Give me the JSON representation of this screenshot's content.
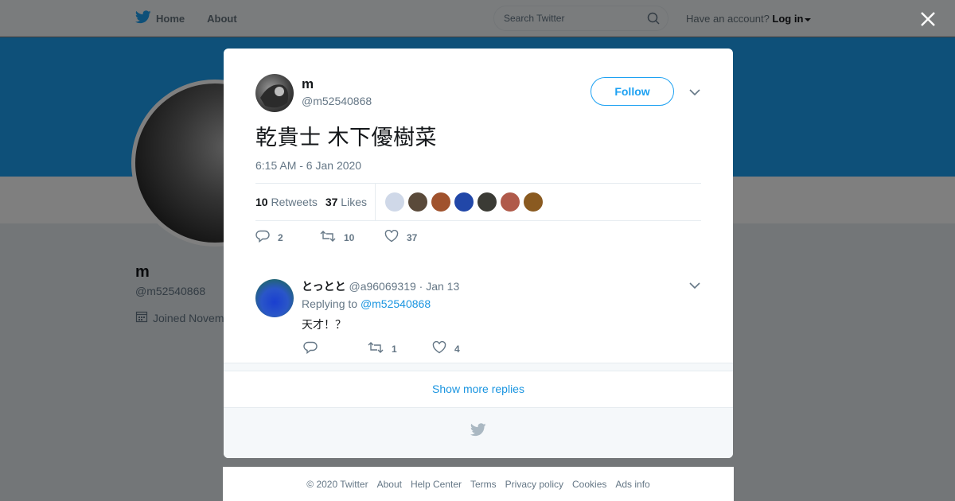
{
  "topbar": {
    "home_label": "Home",
    "about_label": "About",
    "search_placeholder": "Search Twitter",
    "have_account": "Have an account?",
    "login_label": "Log in"
  },
  "profile": {
    "name": "m",
    "handle": "@m52540868",
    "joined": "Joined Novem"
  },
  "tweet": {
    "name": "m",
    "handle": "@m52540868",
    "follow_label": "Follow",
    "text": "乾貴士 木下優樹菜",
    "time": "6:15 AM - 6 Jan 2020",
    "retweets_count": "10",
    "retweets_label": "Retweets",
    "likes_count": "37",
    "likes_label": "Likes",
    "likers": [
      {
        "color": "#cfd8e8"
      },
      {
        "color": "#5a4a3a"
      },
      {
        "color": "#a0522d"
      },
      {
        "color": "#2147a8"
      },
      {
        "color": "#3b3b35"
      },
      {
        "color": "#b05a4a"
      },
      {
        "color": "#8a5a20"
      }
    ],
    "actions": {
      "reply_count": "2",
      "retweet_count": "10",
      "like_count": "37"
    }
  },
  "reply": {
    "name": "とっとと",
    "handle": "@a96069319",
    "date": "· Jan 13",
    "replying_to_label": "Replying to",
    "replying_to_handle": "@m52540868",
    "text": "天才！？",
    "actions": {
      "reply_count": "",
      "retweet_count": "1",
      "like_count": "4"
    }
  },
  "show_more_label": "Show more replies",
  "footer": {
    "links": [
      "© 2020 Twitter",
      "About",
      "Help Center",
      "Terms",
      "Privacy policy",
      "Cookies",
      "Ads info"
    ]
  },
  "colors": {
    "brand": "#1da1f2",
    "link": "#1b95e0",
    "muted": "#657786"
  }
}
